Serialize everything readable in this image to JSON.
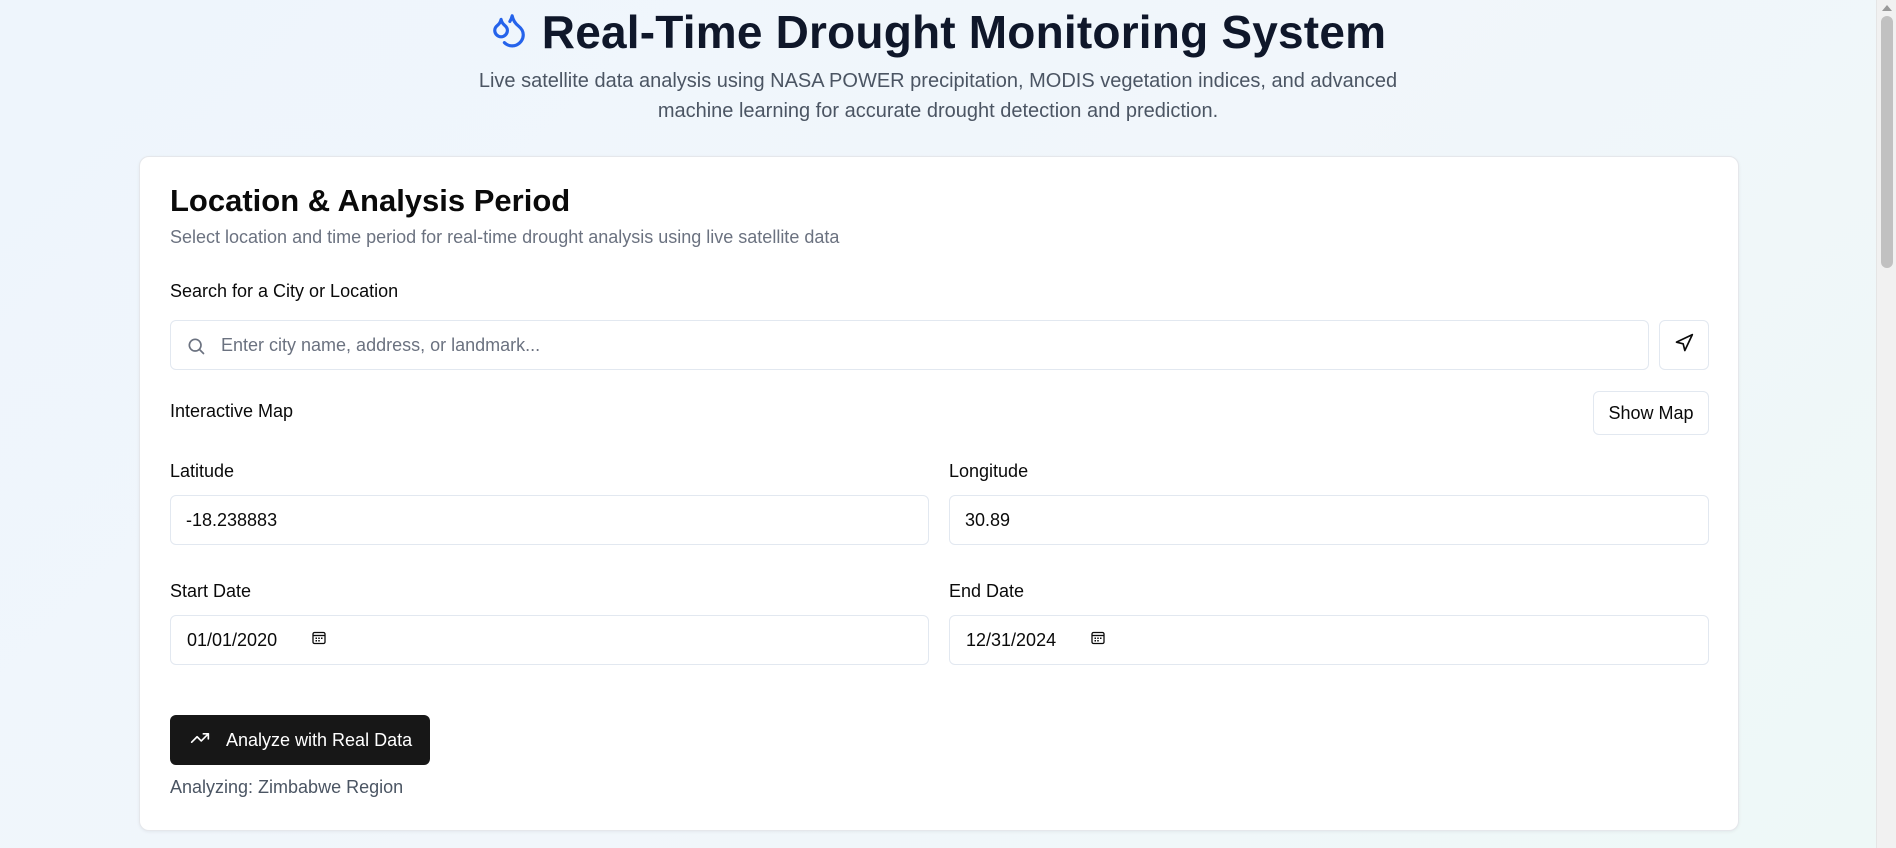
{
  "header": {
    "title": "Real-Time Drought Monitoring System",
    "subtitle": "Live satellite data analysis using NASA POWER precipitation, MODIS vegetation indices, and advanced machine learning for accurate drought detection and prediction.",
    "icon": "droplets-icon",
    "icon_color": "#2563eb"
  },
  "card": {
    "title": "Location & Analysis Period",
    "description": "Select location and time period for real-time drought analysis using live satellite data"
  },
  "search": {
    "label": "Search for a City or Location",
    "placeholder": "Enter city name, address, or landmark...",
    "icon": "search-icon",
    "locate_icon": "navigation-icon"
  },
  "map": {
    "label": "Interactive Map",
    "button_label": "Show Map"
  },
  "coordinates": {
    "latitude_label": "Latitude",
    "latitude_value": "-18.238883",
    "longitude_label": "Longitude",
    "longitude_value": "30.89"
  },
  "dates": {
    "start_label": "Start Date",
    "start_value": "01/01/2020",
    "end_label": "End Date",
    "end_value": "12/31/2024",
    "icon": "calendar-icon"
  },
  "actions": {
    "analyze_label": "Analyze with Real Data",
    "analyze_icon": "trending-up-icon",
    "button_color": "#171717"
  },
  "status": {
    "analyzing_text": "Analyzing: Zimbabwe Region"
  }
}
